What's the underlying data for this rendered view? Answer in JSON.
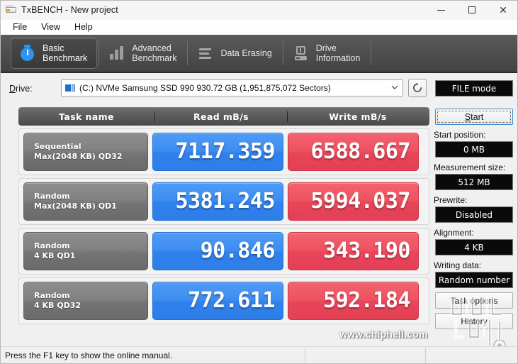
{
  "window": {
    "title": "TxBENCH - New project",
    "icon": "drive-icon",
    "minimize": "—",
    "maximize": "□",
    "close": "✕"
  },
  "menu": {
    "items": [
      {
        "label": "File"
      },
      {
        "label": "View"
      },
      {
        "label": "Help"
      }
    ]
  },
  "tabs": [
    {
      "label": "Basic\nBenchmark",
      "icon": "stopwatch-icon",
      "active": true
    },
    {
      "label": "Advanced\nBenchmark",
      "icon": "bar-chart-icon",
      "active": false
    },
    {
      "label": "Data Erasing",
      "icon": "eraser-icon",
      "active": false
    },
    {
      "label": "Drive\nInformation",
      "icon": "drive-info-icon",
      "active": false
    }
  ],
  "drive": {
    "label": "Drive:",
    "label_mnemonic": "D",
    "selected": "(C:) NVMe Samsung SSD 990  930.72 GB (1,951,875,072 Sectors)",
    "combo_arrow": "⌄",
    "refresh_icon": "refresh-icon"
  },
  "results": {
    "headers": [
      "Task name",
      "Read mB/s",
      "Write mB/s"
    ],
    "rows": [
      {
        "task_line1": "Sequential",
        "task_line2": "Max(2048 KB) QD32",
        "read": "7117.359",
        "write": "6588.667"
      },
      {
        "task_line1": "Random",
        "task_line2": "Max(2048 KB) QD1",
        "read": "5381.245",
        "write": "5994.037"
      },
      {
        "task_line1": "Random",
        "task_line2": "4 KB QD1",
        "read": "90.846",
        "write": "343.190"
      },
      {
        "task_line1": "Random",
        "task_line2": "4 KB QD32",
        "read": "772.611",
        "write": "592.184"
      }
    ]
  },
  "sidebar": {
    "mode_value": "FILE mode",
    "start_label": "Start",
    "start_mnemonic": "S",
    "fields": [
      {
        "label": "Start position:",
        "value": "0 MB"
      },
      {
        "label": "Measurement size:",
        "value": "512 MB"
      },
      {
        "label": "Prewrite:",
        "value": "Disabled"
      },
      {
        "label": "Alignment:",
        "value": "4 KB"
      },
      {
        "label": "Writing data:",
        "value": "Random number"
      }
    ],
    "buttons": [
      {
        "label": "Task options"
      },
      {
        "label": "History"
      }
    ]
  },
  "statusbar": {
    "pane1": "Press the F1 key to show the online manual.",
    "pane2": "",
    "pane3": ""
  },
  "watermark": {
    "text": "www.chiphell.com",
    "logo": "chiphell-logo"
  },
  "colors": {
    "read_accent": "#3d8cf0",
    "write_accent": "#ee5160",
    "tab_strip": "#4e4e4e",
    "task_box": "#818181",
    "lcd_bg": "#0a0a0a",
    "focus_blue": "#3a8ad0"
  }
}
